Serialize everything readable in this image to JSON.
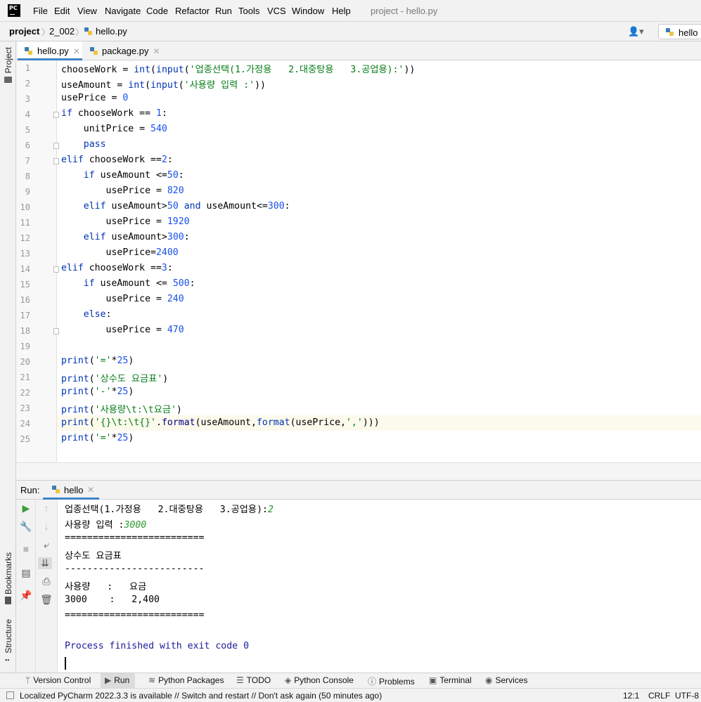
{
  "menubar": {
    "logo": "PC",
    "items": [
      "File",
      "Edit",
      "View",
      "Navigate",
      "Code",
      "Refactor",
      "Run",
      "Tools",
      "VCS",
      "Window",
      "Help"
    ],
    "window_title": "project - hello.py"
  },
  "navbar": {
    "crumbs": [
      "project",
      "2_002",
      "hello.py"
    ],
    "run_config": "hello"
  },
  "left_strip": {
    "project": "Project",
    "bookmarks": "Bookmarks",
    "structure": "Structure"
  },
  "editor_tabs": [
    {
      "label": "hello.py",
      "active": true
    },
    {
      "label": "package.py",
      "active": false
    }
  ],
  "code_lines": [
    "chooseWork = int(input('업종선택(1.가정용   2.대중탕용   3.공업용):'))",
    "useAmount = int(input('사용량 입력 :'))",
    "usePrice = 0",
    "if chooseWork == 1:",
    "    unitPrice = 540",
    "    pass",
    "elif chooseWork ==2:",
    "    if useAmount <=50:",
    "        usePrice = 820",
    "    elif useAmount>50 and useAmount<=300:",
    "        usePrice = 1920",
    "    elif useAmount>300:",
    "        usePrice=2400",
    "elif chooseWork ==3:",
    "    if useAmount <= 500:",
    "        usePrice = 240",
    "    else:",
    "        usePrice = 470",
    "",
    "print('='*25)",
    "print('상수도 요금표')",
    "print('-'*25)",
    "print('사용량\\t:\\t요금')",
    "print('{}\\t:\\t{}'.format(useAmount,format(usePrice,',')))",
    "print('='*25)"
  ],
  "run_panel": {
    "label": "Run:",
    "tab": "hello",
    "output": [
      {
        "text": "업종선택(1.가정용   2.대중탕용   3.공업용):",
        "input": "2"
      },
      {
        "text": "사용량 입력 :",
        "input": "3000"
      },
      {
        "text": "========================="
      },
      {
        "text": "상수도 요금표"
      },
      {
        "text": "-------------------------"
      },
      {
        "text": "사용량   :   요금"
      },
      {
        "text": "3000    :   2,400"
      },
      {
        "text": "========================="
      },
      {
        "text": ""
      },
      {
        "text": "Process finished with exit code 0",
        "style": "proc"
      }
    ]
  },
  "bottom_tools": [
    "Version Control",
    "Run",
    "Python Packages",
    "TODO",
    "Python Console",
    "Problems",
    "Terminal",
    "Services"
  ],
  "status": {
    "message": "Localized PyCharm 2022.3.3 is available // Switch and restart // Don't ask again (50 minutes ago)",
    "position": "12:1",
    "line_sep": "CRLF",
    "encoding": "UTF-8"
  },
  "colors": {
    "keyword": "#0033b3",
    "number": "#1750eb",
    "string": "#067d17",
    "user_input": "#2d9a2d",
    "accent": "#4083c9"
  }
}
